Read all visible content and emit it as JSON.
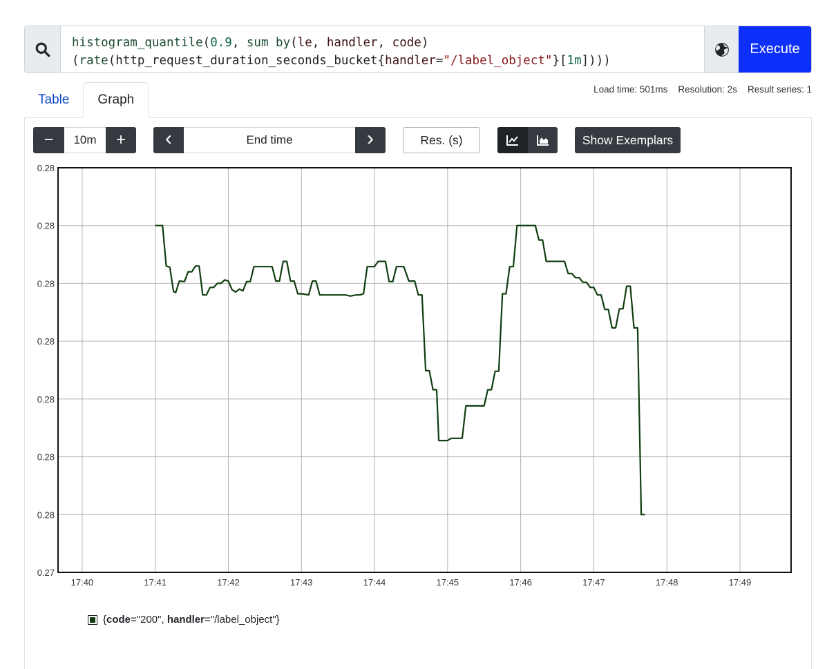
{
  "query": {
    "lines": [
      [
        {
          "t": "histogram_quantile",
          "c": "tk-fn"
        },
        {
          "t": "(",
          "c": "tk-pl"
        },
        {
          "t": "0.9",
          "c": "tk-num"
        },
        {
          "t": ", ",
          "c": "tk-pl"
        },
        {
          "t": "sum by",
          "c": "tk-fn"
        },
        {
          "t": "(",
          "c": "tk-pl"
        },
        {
          "t": "le",
          "c": "tk-lbl"
        },
        {
          "t": ", ",
          "c": "tk-pl"
        },
        {
          "t": "handler",
          "c": "tk-lbl"
        },
        {
          "t": ", ",
          "c": "tk-pl"
        },
        {
          "t": "code",
          "c": "tk-lbl"
        },
        {
          "t": ")",
          "c": "tk-pl"
        }
      ],
      [
        {
          "t": "(",
          "c": "tk-pl"
        },
        {
          "t": "rate",
          "c": "tk-fn"
        },
        {
          "t": "(",
          "c": "tk-pl"
        },
        {
          "t": "http_request_duration_seconds_bucket",
          "c": "tk-pl"
        },
        {
          "t": "{",
          "c": "tk-pl"
        },
        {
          "t": "handler",
          "c": "tk-lbl"
        },
        {
          "t": "=",
          "c": "tk-pl"
        },
        {
          "t": "\"/label_object\"",
          "c": "tk-str"
        },
        {
          "t": "}",
          "c": "tk-pl"
        },
        {
          "t": "[",
          "c": "tk-pl"
        },
        {
          "t": "1m",
          "c": "tk-num"
        },
        {
          "t": "])))",
          "c": "tk-pl"
        }
      ]
    ],
    "search_icon": "search-icon",
    "globe_icon": "globe-icon",
    "execute_label": "Execute"
  },
  "tabs": {
    "table": "Table",
    "graph": "Graph"
  },
  "stats": {
    "load_time": "Load time: 501ms",
    "resolution": "Resolution: 2s",
    "result_series": "Result series: 1"
  },
  "controls": {
    "minus": "−",
    "range": "10m",
    "plus": "+",
    "prev": "‹",
    "end_time_placeholder": "End time",
    "next": "›",
    "resolution_placeholder": "Res. (s)",
    "line_icon": "line-chart-icon",
    "stacked_icon": "area-chart-icon",
    "exemplars": "Show Exemplars"
  },
  "colors": {
    "series": "#0f3d0f",
    "execute": "#0d2ffb"
  },
  "chart_data": {
    "type": "line",
    "y_tick_labels": [
      "0.28",
      "0.28",
      "0.28",
      "0.28",
      "0.28",
      "0.28",
      "0.28",
      "0.27"
    ],
    "x_tick_labels": [
      "17:40",
      "17:41",
      "17:42",
      "17:43",
      "17:44",
      "17:45",
      "17:46",
      "17:47",
      "17:48",
      "17:49"
    ],
    "x_range_minutes": [
      -0.33,
      9.7
    ],
    "y_range_level": [
      0,
      7
    ],
    "grid": true,
    "legend_position": "bottom-left",
    "series": [
      {
        "color": "#0f3d0f",
        "points": [
          [
            1.0,
            6.0
          ],
          [
            1.1,
            6.0
          ],
          [
            1.15,
            5.3
          ],
          [
            1.2,
            5.28
          ],
          [
            1.25,
            4.86
          ],
          [
            1.28,
            4.84
          ],
          [
            1.33,
            5.04
          ],
          [
            1.4,
            5.03
          ],
          [
            1.45,
            5.2
          ],
          [
            1.5,
            5.2
          ],
          [
            1.55,
            5.3
          ],
          [
            1.6,
            5.3
          ],
          [
            1.65,
            4.8
          ],
          [
            1.7,
            4.8
          ],
          [
            1.75,
            4.93
          ],
          [
            1.8,
            4.93
          ],
          [
            1.85,
            5.0
          ],
          [
            1.9,
            5.0
          ],
          [
            1.95,
            5.06
          ],
          [
            2.0,
            5.04
          ],
          [
            2.05,
            4.89
          ],
          [
            2.1,
            4.85
          ],
          [
            2.15,
            4.9
          ],
          [
            2.2,
            4.87
          ],
          [
            2.25,
            5.03
          ],
          [
            2.3,
            5.03
          ],
          [
            2.35,
            5.29
          ],
          [
            2.5,
            5.29
          ],
          [
            2.6,
            5.29
          ],
          [
            2.65,
            5.04
          ],
          [
            2.7,
            5.04
          ],
          [
            2.75,
            5.38
          ],
          [
            2.8,
            5.38
          ],
          [
            2.85,
            5.04
          ],
          [
            2.9,
            5.04
          ],
          [
            2.95,
            4.82
          ],
          [
            3.0,
            4.82
          ],
          [
            3.1,
            4.8
          ],
          [
            3.15,
            5.04
          ],
          [
            3.2,
            5.04
          ],
          [
            3.25,
            4.8
          ],
          [
            3.4,
            4.8
          ],
          [
            3.6,
            4.8
          ],
          [
            3.67,
            4.78
          ],
          [
            3.75,
            4.8
          ],
          [
            3.8,
            4.8
          ],
          [
            3.85,
            4.82
          ],
          [
            3.9,
            5.29
          ],
          [
            4.0,
            5.29
          ],
          [
            4.05,
            5.38
          ],
          [
            4.15,
            5.38
          ],
          [
            4.2,
            5.03
          ],
          [
            4.25,
            5.03
          ],
          [
            4.3,
            5.29
          ],
          [
            4.4,
            5.29
          ],
          [
            4.47,
            5.04
          ],
          [
            4.55,
            5.04
          ],
          [
            4.6,
            4.8
          ],
          [
            4.65,
            4.8
          ],
          [
            4.7,
            3.49
          ],
          [
            4.75,
            3.49
          ],
          [
            4.8,
            3.16
          ],
          [
            4.85,
            3.16
          ],
          [
            4.88,
            2.28
          ],
          [
            5.0,
            2.28
          ],
          [
            5.05,
            2.32
          ],
          [
            5.2,
            2.32
          ],
          [
            5.25,
            2.88
          ],
          [
            5.45,
            2.88
          ],
          [
            5.5,
            2.88
          ],
          [
            5.55,
            3.16
          ],
          [
            5.6,
            3.16
          ],
          [
            5.65,
            3.48
          ],
          [
            5.7,
            3.48
          ],
          [
            5.75,
            4.82
          ],
          [
            5.8,
            4.82
          ],
          [
            5.85,
            5.29
          ],
          [
            5.9,
            5.29
          ],
          [
            5.95,
            6.0
          ],
          [
            6.05,
            6.0
          ],
          [
            6.2,
            6.0
          ],
          [
            6.25,
            5.75
          ],
          [
            6.3,
            5.75
          ],
          [
            6.35,
            5.38
          ],
          [
            6.5,
            5.38
          ],
          [
            6.55,
            5.38
          ],
          [
            6.6,
            5.38
          ],
          [
            6.65,
            5.17
          ],
          [
            6.7,
            5.17
          ],
          [
            6.75,
            5.1
          ],
          [
            6.8,
            5.1
          ],
          [
            6.85,
            5.02
          ],
          [
            6.9,
            5.02
          ],
          [
            6.95,
            4.93
          ],
          [
            7.0,
            4.93
          ],
          [
            7.05,
            4.8
          ],
          [
            7.1,
            4.8
          ],
          [
            7.15,
            4.55
          ],
          [
            7.2,
            4.55
          ],
          [
            7.25,
            4.23
          ],
          [
            7.3,
            4.23
          ],
          [
            7.35,
            4.56
          ],
          [
            7.4,
            4.56
          ],
          [
            7.45,
            4.95
          ],
          [
            7.5,
            4.95
          ],
          [
            7.55,
            4.23
          ],
          [
            7.6,
            4.23
          ],
          [
            7.65,
            1.0
          ],
          [
            7.7,
            1.0
          ]
        ]
      }
    ],
    "legend": {
      "open": "{",
      "k1": "code",
      "v1": "=\"200\", ",
      "k2": "handler",
      "v2": "=\"/label_object\"}"
    }
  }
}
